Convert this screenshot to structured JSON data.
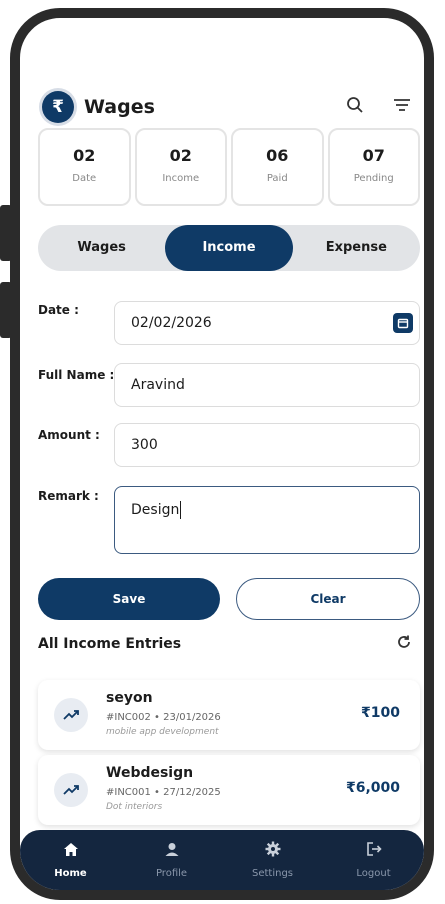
{
  "app": {
    "title": "Wages",
    "logo_symbol": "₹"
  },
  "header": {
    "search_icon": "search-icon",
    "filter_icon": "filter-icon"
  },
  "stats": [
    {
      "value": "02",
      "label": "Date"
    },
    {
      "value": "02",
      "label": "Income"
    },
    {
      "value": "06",
      "label": "Paid"
    },
    {
      "value": "07",
      "label": "Pending"
    }
  ],
  "tabs": [
    {
      "label": "Wages",
      "active": false
    },
    {
      "label": "Income",
      "active": true
    },
    {
      "label": "Expense",
      "active": false
    }
  ],
  "form": {
    "date_label": "Date :",
    "date_value": "02/02/2026",
    "name_label": "Full Name :",
    "name_value": "Aravind",
    "amount_label": "Amount :",
    "amount_value": "300",
    "remark_label": "Remark :",
    "remark_value": "Design"
  },
  "buttons": {
    "save": "Save",
    "clear": "Clear"
  },
  "entries_section": {
    "title": "All Income Entries"
  },
  "entries": [
    {
      "name": "seyon",
      "meta": "#INC002 • 23/01/2026",
      "note": "mobile app development",
      "amount": "₹100"
    },
    {
      "name": "Webdesign",
      "meta": "#INC001 • 27/12/2025",
      "note": "Dot interiors",
      "amount": "₹6,000"
    }
  ],
  "nav": [
    {
      "label": "Home",
      "icon": "home-icon",
      "active": true
    },
    {
      "label": "Profile",
      "icon": "profile-icon",
      "active": false
    },
    {
      "label": "Settings",
      "icon": "gear-icon",
      "active": false
    },
    {
      "label": "Logout",
      "icon": "logout-icon",
      "active": false
    }
  ],
  "colors": {
    "primary": "#0f3a66",
    "nav_bg": "#14263f",
    "tab_track": "#e2e4e7"
  }
}
